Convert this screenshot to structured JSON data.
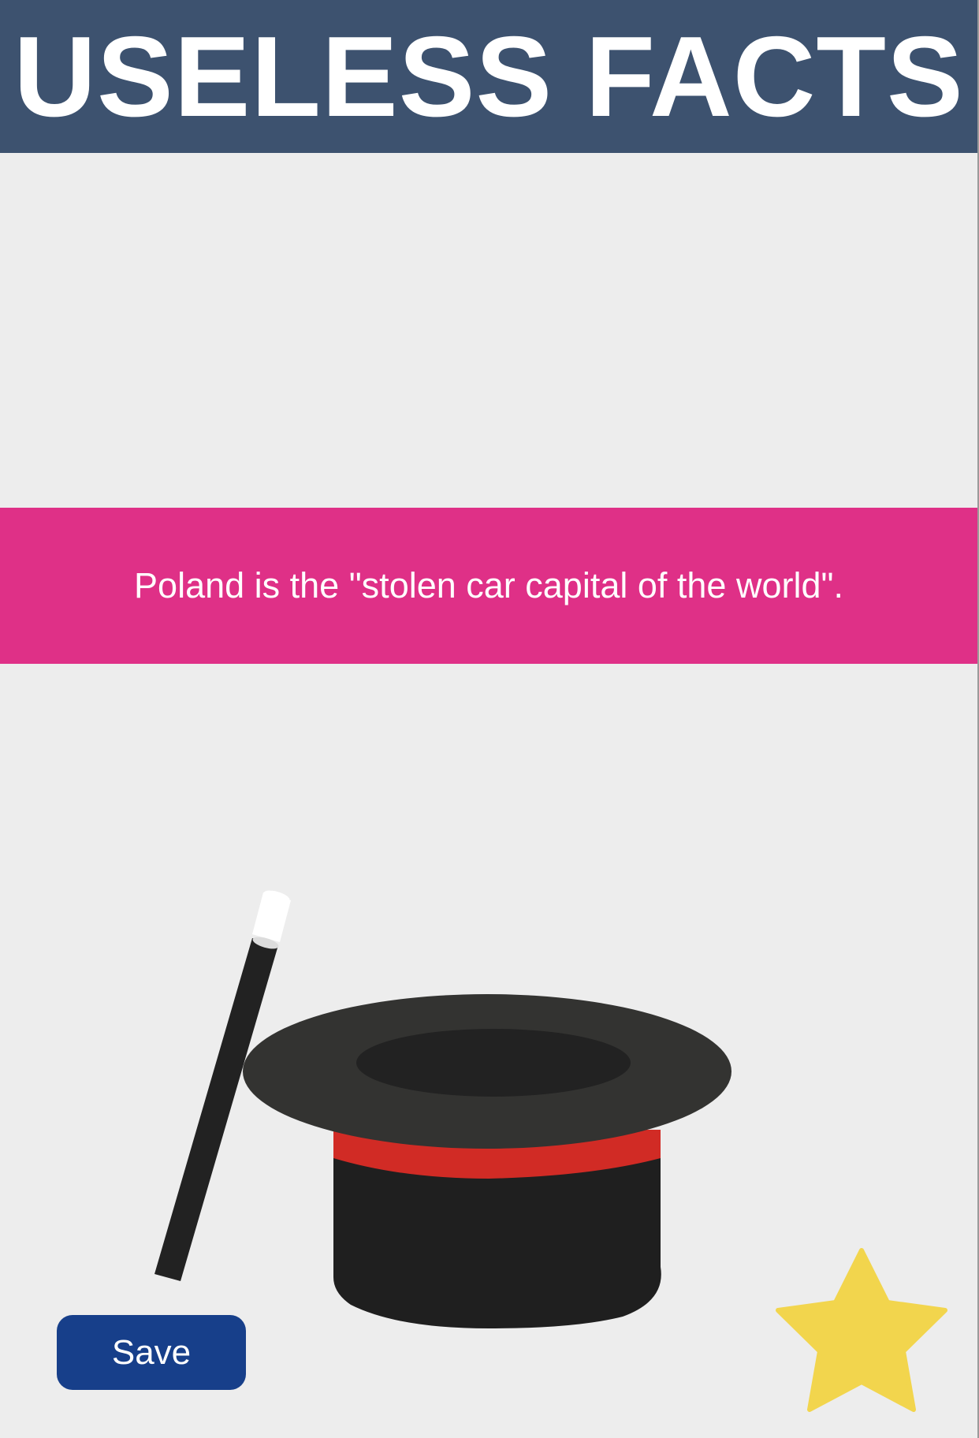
{
  "header": {
    "title": "USELESS FACTS",
    "background_color": "#3d526f"
  },
  "fact": {
    "text": "Poland is the \"stolen car capital of the world\".",
    "background_color": "#df3087"
  },
  "illustration": {
    "icons": [
      "magic-wand-icon",
      "top-hat-icon"
    ]
  },
  "actions": {
    "save_label": "Save",
    "save_color": "#173f8a",
    "favorite_icon": "star-icon",
    "favorite_color": "#f2d54d"
  }
}
